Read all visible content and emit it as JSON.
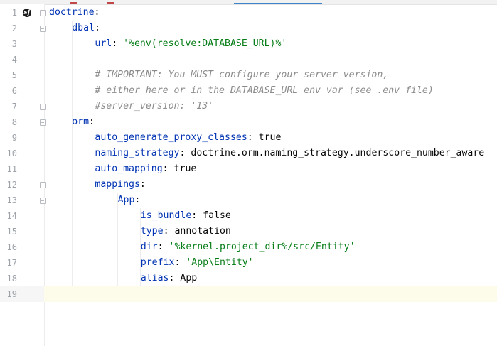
{
  "editor": {
    "language": "yaml",
    "current_line": 19,
    "lines": [
      {
        "n": "1",
        "indent": 0,
        "key": "doctrine",
        "sep": ":",
        "value": "",
        "type": "key"
      },
      {
        "n": "2",
        "indent": 1,
        "key": "dbal",
        "sep": ":",
        "value": "",
        "type": "key"
      },
      {
        "n": "3",
        "indent": 2,
        "key": "url",
        "sep": ": ",
        "value": "'%env(resolve:DATABASE_URL)%'",
        "type": "string"
      },
      {
        "n": "4",
        "indent": 0,
        "key": "",
        "sep": "",
        "value": "",
        "type": "empty"
      },
      {
        "n": "5",
        "indent": 2,
        "key": "",
        "sep": "",
        "value": "# IMPORTANT: You MUST configure your server version,",
        "type": "comment"
      },
      {
        "n": "6",
        "indent": 2,
        "key": "",
        "sep": "",
        "value": "# either here or in the DATABASE_URL env var (see .env file)",
        "type": "comment"
      },
      {
        "n": "7",
        "indent": 2,
        "key": "",
        "sep": "",
        "value": "#server_version: '13'",
        "type": "comment"
      },
      {
        "n": "8",
        "indent": 1,
        "key": "orm",
        "sep": ":",
        "value": "",
        "type": "key"
      },
      {
        "n": "9",
        "indent": 2,
        "key": "auto_generate_proxy_classes",
        "sep": ": ",
        "value": "true",
        "type": "plain"
      },
      {
        "n": "10",
        "indent": 2,
        "key": "naming_strategy",
        "sep": ": ",
        "value": "doctrine.orm.naming_strategy.underscore_number_aware",
        "type": "plain"
      },
      {
        "n": "11",
        "indent": 2,
        "key": "auto_mapping",
        "sep": ": ",
        "value": "true",
        "type": "plain"
      },
      {
        "n": "12",
        "indent": 2,
        "key": "mappings",
        "sep": ":",
        "value": "",
        "type": "key"
      },
      {
        "n": "13",
        "indent": 3,
        "key": "App",
        "sep": ":",
        "value": "",
        "type": "key"
      },
      {
        "n": "14",
        "indent": 4,
        "key": "is_bundle",
        "sep": ": ",
        "value": "false",
        "type": "plain"
      },
      {
        "n": "15",
        "indent": 4,
        "key": "type",
        "sep": ": ",
        "value": "annotation",
        "type": "plain"
      },
      {
        "n": "16",
        "indent": 4,
        "key": "dir",
        "sep": ": ",
        "value": "'%kernel.project_dir%/src/Entity'",
        "type": "string"
      },
      {
        "n": "17",
        "indent": 4,
        "key": "prefix",
        "sep": ": ",
        "value": "'App\\Entity'",
        "type": "string"
      },
      {
        "n": "18",
        "indent": 4,
        "key": "alias",
        "sep": ": ",
        "value": "App",
        "type": "plain"
      },
      {
        "n": "19",
        "indent": 0,
        "key": "",
        "sep": "",
        "value": "",
        "type": "empty"
      }
    ],
    "fold_markers": [
      {
        "line": 1,
        "kind": "start"
      },
      {
        "line": 2,
        "kind": "start"
      },
      {
        "line": 7,
        "kind": "end"
      },
      {
        "line": 8,
        "kind": "start"
      },
      {
        "line": 12,
        "kind": "start"
      },
      {
        "line": 13,
        "kind": "start"
      }
    ],
    "gutter_icon": {
      "line": 1,
      "name": "symfony-icon",
      "glyph": "sf"
    }
  },
  "colors": {
    "key": "#0033b3",
    "string": "#067d17",
    "comment": "#8c8c8c",
    "text": "#080808",
    "line_number": "#9da2a8",
    "current_line_bg": "#fdfbe9"
  }
}
